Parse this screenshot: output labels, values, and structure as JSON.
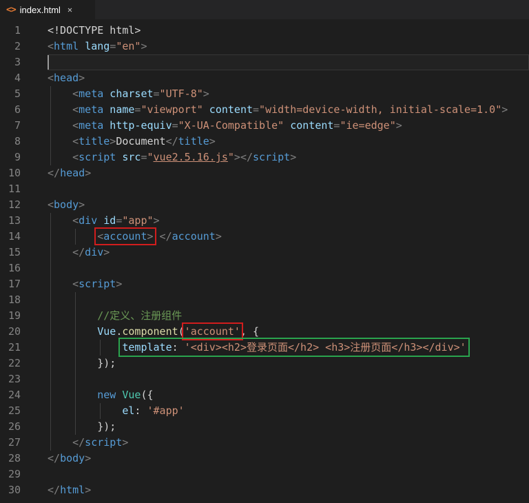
{
  "tab": {
    "title": "index.html",
    "icon_glyph": "<>",
    "close_glyph": "✕"
  },
  "colors": {
    "editor_bg": "#1e1e1e",
    "tabbar_bg": "#252526",
    "tag": "#569cd6",
    "attribute": "#9cdcfe",
    "string": "#ce9178",
    "comment": "#6a9955",
    "function": "#dcdcaa",
    "class": "#4ec9b0",
    "line_number": "#858585",
    "annotation_red": "#d21d1d",
    "annotation_green": "#2aa44e",
    "file_icon_orange": "#e37933"
  },
  "editor": {
    "lines": [
      {
        "num": "1",
        "indent": 0,
        "guides": 0,
        "tokens": [
          {
            "t": "<!DOCTYPE html>",
            "c": "plain"
          }
        ]
      },
      {
        "num": "2",
        "indent": 0,
        "guides": 0,
        "tokens": [
          {
            "t": "<",
            "c": "punct"
          },
          {
            "t": "html",
            "c": "tag"
          },
          {
            "t": " ",
            "c": "plain"
          },
          {
            "t": "lang",
            "c": "attr"
          },
          {
            "t": "=",
            "c": "punct"
          },
          {
            "t": "\"en\"",
            "c": "str"
          },
          {
            "t": ">",
            "c": "punct"
          }
        ]
      },
      {
        "num": "3",
        "indent": 0,
        "guides": 0,
        "current": true,
        "tokens": []
      },
      {
        "num": "4",
        "indent": 0,
        "guides": 0,
        "tokens": [
          {
            "t": "<",
            "c": "punct"
          },
          {
            "t": "head",
            "c": "tag"
          },
          {
            "t": ">",
            "c": "punct"
          }
        ]
      },
      {
        "num": "5",
        "indent": 4,
        "guides": 1,
        "tokens": [
          {
            "t": "<",
            "c": "punct"
          },
          {
            "t": "meta",
            "c": "tag"
          },
          {
            "t": " ",
            "c": "plain"
          },
          {
            "t": "charset",
            "c": "attr"
          },
          {
            "t": "=",
            "c": "punct"
          },
          {
            "t": "\"UTF-8\"",
            "c": "str"
          },
          {
            "t": ">",
            "c": "punct"
          }
        ]
      },
      {
        "num": "6",
        "indent": 4,
        "guides": 1,
        "tokens": [
          {
            "t": "<",
            "c": "punct"
          },
          {
            "t": "meta",
            "c": "tag"
          },
          {
            "t": " ",
            "c": "plain"
          },
          {
            "t": "name",
            "c": "attr"
          },
          {
            "t": "=",
            "c": "punct"
          },
          {
            "t": "\"viewport\"",
            "c": "str"
          },
          {
            "t": " ",
            "c": "plain"
          },
          {
            "t": "content",
            "c": "attr"
          },
          {
            "t": "=",
            "c": "punct"
          },
          {
            "t": "\"width=device-width, initial-scale=1.0\"",
            "c": "str"
          },
          {
            "t": ">",
            "c": "punct"
          }
        ]
      },
      {
        "num": "7",
        "indent": 4,
        "guides": 1,
        "tokens": [
          {
            "t": "<",
            "c": "punct"
          },
          {
            "t": "meta",
            "c": "tag"
          },
          {
            "t": " ",
            "c": "plain"
          },
          {
            "t": "http-equiv",
            "c": "attr"
          },
          {
            "t": "=",
            "c": "punct"
          },
          {
            "t": "\"X-UA-Compatible\"",
            "c": "str"
          },
          {
            "t": " ",
            "c": "plain"
          },
          {
            "t": "content",
            "c": "attr"
          },
          {
            "t": "=",
            "c": "punct"
          },
          {
            "t": "\"ie=edge\"",
            "c": "str"
          },
          {
            "t": ">",
            "c": "punct"
          }
        ]
      },
      {
        "num": "8",
        "indent": 4,
        "guides": 1,
        "tokens": [
          {
            "t": "<",
            "c": "punct"
          },
          {
            "t": "title",
            "c": "tag"
          },
          {
            "t": ">",
            "c": "punct"
          },
          {
            "t": "Document",
            "c": "plain"
          },
          {
            "t": "</",
            "c": "punct"
          },
          {
            "t": "title",
            "c": "tag"
          },
          {
            "t": ">",
            "c": "punct"
          }
        ]
      },
      {
        "num": "9",
        "indent": 4,
        "guides": 1,
        "tokens": [
          {
            "t": "<",
            "c": "punct"
          },
          {
            "t": "script",
            "c": "tag"
          },
          {
            "t": " ",
            "c": "plain"
          },
          {
            "t": "src",
            "c": "attr"
          },
          {
            "t": "=",
            "c": "punct"
          },
          {
            "t": "\"",
            "c": "str"
          },
          {
            "t": "vue2.5.16.js",
            "c": "link"
          },
          {
            "t": "\"",
            "c": "str"
          },
          {
            "t": ">",
            "c": "punct"
          },
          {
            "t": "</",
            "c": "punct"
          },
          {
            "t": "script",
            "c": "tag"
          },
          {
            "t": ">",
            "c": "punct"
          }
        ]
      },
      {
        "num": "10",
        "indent": 0,
        "guides": 0,
        "tokens": [
          {
            "t": "</",
            "c": "punct"
          },
          {
            "t": "head",
            "c": "tag"
          },
          {
            "t": ">",
            "c": "punct"
          }
        ]
      },
      {
        "num": "11",
        "indent": 0,
        "guides": 0,
        "tokens": []
      },
      {
        "num": "12",
        "indent": 0,
        "guides": 0,
        "tokens": [
          {
            "t": "<",
            "c": "punct"
          },
          {
            "t": "body",
            "c": "tag"
          },
          {
            "t": ">",
            "c": "punct"
          }
        ]
      },
      {
        "num": "13",
        "indent": 4,
        "guides": 1,
        "tokens": [
          {
            "t": "<",
            "c": "punct"
          },
          {
            "t": "div",
            "c": "tag"
          },
          {
            "t": " ",
            "c": "plain"
          },
          {
            "t": "id",
            "c": "attr"
          },
          {
            "t": "=",
            "c": "punct"
          },
          {
            "t": "\"app\"",
            "c": "str"
          },
          {
            "t": ">",
            "c": "punct"
          }
        ]
      },
      {
        "num": "14",
        "indent": 8,
        "guides": 2,
        "tokens": [
          {
            "t": "<",
            "c": "punct",
            "box": "red"
          },
          {
            "t": "account",
            "c": "tag",
            "box": "red"
          },
          {
            "t": ">",
            "c": "punct",
            "box": "red"
          },
          {
            "t": " ",
            "c": "plain"
          },
          {
            "t": "</",
            "c": "punct"
          },
          {
            "t": "account",
            "c": "tag"
          },
          {
            "t": ">",
            "c": "punct"
          }
        ]
      },
      {
        "num": "15",
        "indent": 4,
        "guides": 1,
        "tokens": [
          {
            "t": "</",
            "c": "punct"
          },
          {
            "t": "div",
            "c": "tag"
          },
          {
            "t": ">",
            "c": "punct"
          }
        ]
      },
      {
        "num": "16",
        "indent": 0,
        "guides": 1,
        "tokens": []
      },
      {
        "num": "17",
        "indent": 4,
        "guides": 1,
        "tokens": [
          {
            "t": "<",
            "c": "punct"
          },
          {
            "t": "script",
            "c": "tag"
          },
          {
            "t": ">",
            "c": "punct"
          }
        ]
      },
      {
        "num": "18",
        "indent": 0,
        "guides": 2,
        "tokens": []
      },
      {
        "num": "19",
        "indent": 8,
        "guides": 2,
        "tokens": [
          {
            "t": "//定义、注册组件",
            "c": "comment"
          }
        ]
      },
      {
        "num": "20",
        "indent": 8,
        "guides": 2,
        "tokens": [
          {
            "t": "Vue",
            "c": "var"
          },
          {
            "t": ".",
            "c": "plain"
          },
          {
            "t": "component",
            "c": "func"
          },
          {
            "t": "(",
            "c": "plain"
          },
          {
            "t": "'account'",
            "c": "str",
            "box": "red"
          },
          {
            "t": ",",
            "c": "plain"
          },
          {
            "t": " ",
            "c": "plain"
          },
          {
            "t": "{",
            "c": "plain"
          }
        ]
      },
      {
        "num": "21",
        "indent": 12,
        "guides": 3,
        "tokens": [
          {
            "t": "template",
            "c": "attr",
            "box": "green"
          },
          {
            "t": ":",
            "c": "plain",
            "box": "green"
          },
          {
            "t": " ",
            "c": "plain",
            "box": "green"
          },
          {
            "t": "'<div><h2>登录页面</h2> <h3>注册页面</h3></div>'",
            "c": "str",
            "box": "green"
          }
        ]
      },
      {
        "num": "22",
        "indent": 8,
        "guides": 2,
        "tokens": [
          {
            "t": "});",
            "c": "plain"
          }
        ]
      },
      {
        "num": "23",
        "indent": 0,
        "guides": 2,
        "tokens": []
      },
      {
        "num": "24",
        "indent": 8,
        "guides": 2,
        "tokens": [
          {
            "t": "new",
            "c": "kw"
          },
          {
            "t": " ",
            "c": "plain"
          },
          {
            "t": "Vue",
            "c": "cls"
          },
          {
            "t": "({",
            "c": "plain"
          }
        ]
      },
      {
        "num": "25",
        "indent": 12,
        "guides": 3,
        "tokens": [
          {
            "t": "el",
            "c": "attr"
          },
          {
            "t": ":",
            "c": "plain"
          },
          {
            "t": " ",
            "c": "plain"
          },
          {
            "t": "'#app'",
            "c": "str"
          }
        ]
      },
      {
        "num": "26",
        "indent": 8,
        "guides": 2,
        "tokens": [
          {
            "t": "});",
            "c": "plain"
          }
        ]
      },
      {
        "num": "27",
        "indent": 4,
        "guides": 1,
        "tokens": [
          {
            "t": "</",
            "c": "punct"
          },
          {
            "t": "script",
            "c": "tag"
          },
          {
            "t": ">",
            "c": "punct"
          }
        ]
      },
      {
        "num": "28",
        "indent": 0,
        "guides": 0,
        "tokens": [
          {
            "t": "</",
            "c": "punct"
          },
          {
            "t": "body",
            "c": "tag"
          },
          {
            "t": ">",
            "c": "punct"
          }
        ]
      },
      {
        "num": "29",
        "indent": 0,
        "guides": 0,
        "tokens": []
      },
      {
        "num": "30",
        "indent": 0,
        "guides": 0,
        "tokens": [
          {
            "t": "</",
            "c": "punct"
          },
          {
            "t": "html",
            "c": "tag"
          },
          {
            "t": ">",
            "c": "punct"
          }
        ]
      }
    ]
  }
}
